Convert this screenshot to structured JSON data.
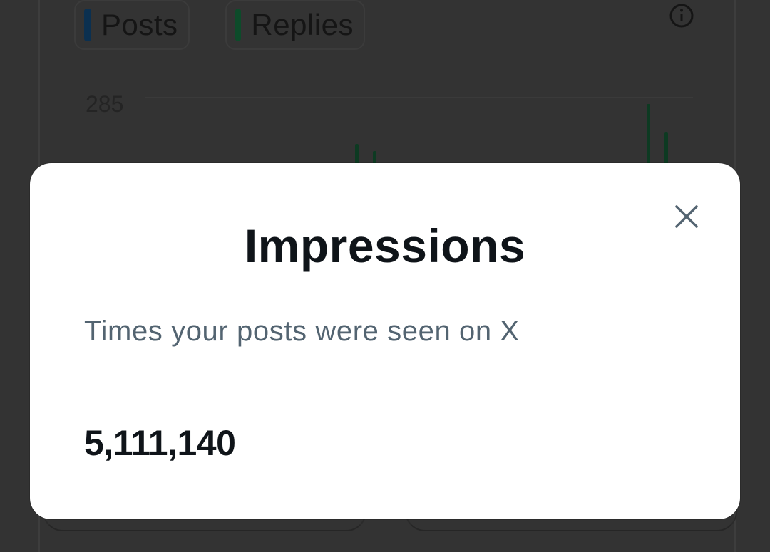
{
  "background_chart": {
    "legend": [
      {
        "label": "Posts",
        "color": "#0b3050"
      },
      {
        "label": "Replies",
        "color": "#0d4b2a"
      }
    ],
    "y_tick": "285",
    "info_icon": "info-icon"
  },
  "modal": {
    "title": "Impressions",
    "description": "Times your posts were seen on X",
    "value": "5,111,140",
    "close_icon": "close-icon"
  }
}
